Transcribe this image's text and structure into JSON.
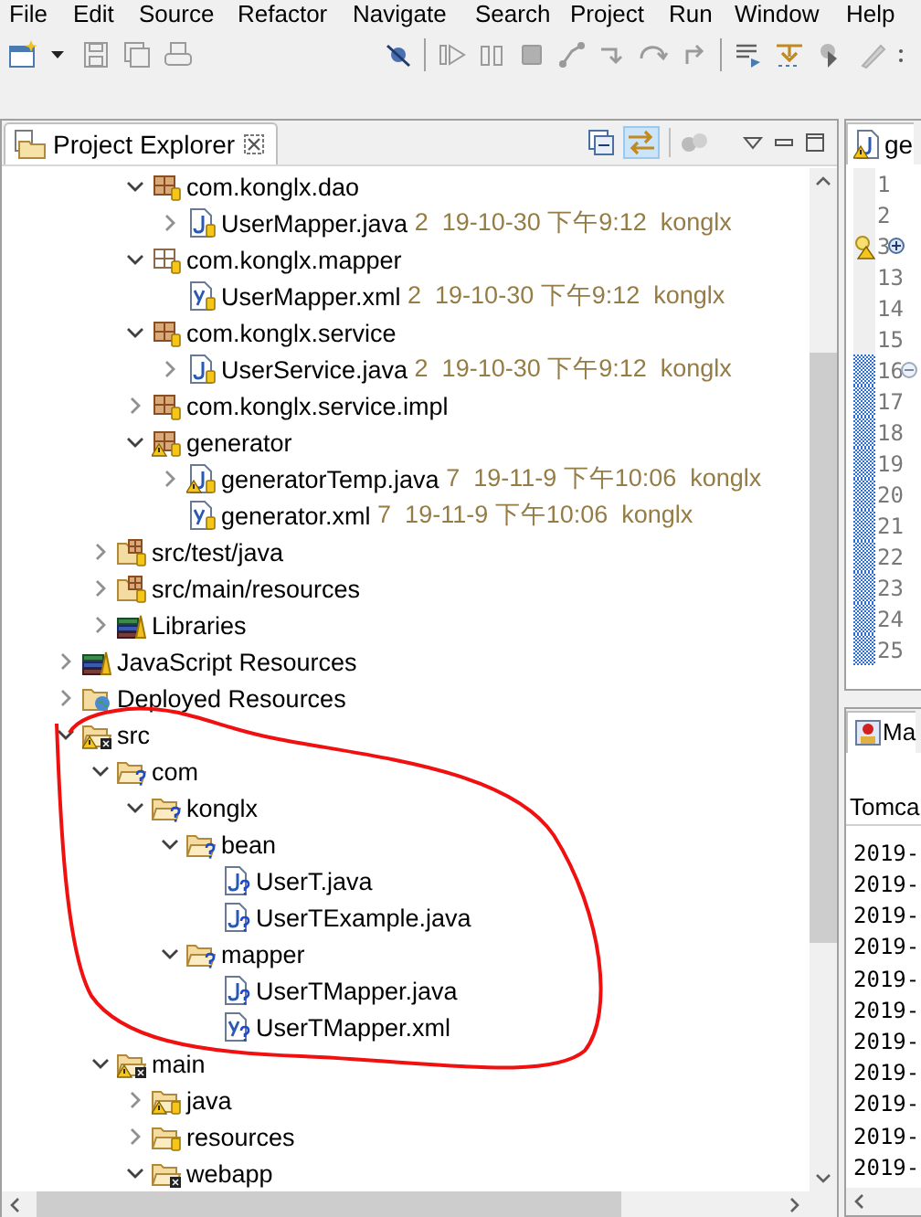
{
  "menu_bar": {
    "items": [
      "File",
      "Edit",
      "Source",
      "Refactor",
      "Navigate",
      "Search",
      "Project",
      "Run",
      "Window",
      "Help"
    ]
  },
  "project_explorer": {
    "tab": {
      "label": "Project Explorer"
    },
    "tree": [
      {
        "children": [
          {
            "children": [
              {
                "label": "com.konglx.dao",
                "kind": "package",
                "expanded": true,
                "children": [
                  {
                    "label": "UserMapper.java",
                    "decoration": "2  19-10-30 下午9:12  konglx",
                    "kind": "javafile",
                    "expanded": false
                  }
                ]
              },
              {
                "label": "com.konglx.mapper",
                "kind": "emptypackage",
                "expanded": true,
                "children": [
                  {
                    "label": "UserMapper.xml",
                    "decoration": "2  19-10-30 下午9:12  konglx",
                    "kind": "xmlfile"
                  }
                ]
              },
              {
                "label": "com.konglx.service",
                "kind": "package",
                "expanded": true,
                "children": [
                  {
                    "label": "UserService.java",
                    "decoration": "2  19-10-30 下午9:12  konglx",
                    "kind": "javafile",
                    "expanded": false
                  }
                ]
              },
              {
                "label": "com.konglx.service.impl",
                "kind": "package",
                "expanded": false
              },
              {
                "label": "generator",
                "kind": "warnpackage",
                "expanded": true,
                "children": [
                  {
                    "label": "generatorTemp.java",
                    "decoration": "7  19-11-9 下午10:06  konglx",
                    "kind": "warnjavafile",
                    "expanded": false
                  },
                  {
                    "label": "generator.xml",
                    "decoration": "7  19-11-9 下午10:06  konglx",
                    "kind": "xmlfile"
                  }
                ]
              }
            ]
          },
          {
            "label": "src/test/java",
            "kind": "sourcefolder",
            "expanded": false
          },
          {
            "label": "src/main/resources",
            "kind": "sourcefolder",
            "expanded": false
          },
          {
            "label": "Libraries",
            "kind": "library",
            "expanded": false
          }
        ]
      },
      {
        "label": "JavaScript Resources",
        "kind": "library",
        "expanded": false
      },
      {
        "label": "Deployed Resources",
        "kind": "deployed",
        "expanded": false
      },
      {
        "label": "src",
        "kind": "warnwebfolder",
        "expanded": true,
        "children": [
          {
            "label": "com",
            "kind": "newfolder",
            "expanded": true,
            "children": [
              {
                "label": "konglx",
                "kind": "newfolder",
                "expanded": true,
                "children": [
                  {
                    "label": "bean",
                    "kind": "newfolder",
                    "expanded": true,
                    "children": [
                      {
                        "label": "UserT.java",
                        "kind": "newjavafile"
                      },
                      {
                        "label": "UserTExample.java",
                        "kind": "newjavafile"
                      }
                    ]
                  },
                  {
                    "label": "mapper",
                    "kind": "newfolder",
                    "expanded": true,
                    "children": [
                      {
                        "label": "UserTMapper.java",
                        "kind": "newjavafile"
                      },
                      {
                        "label": "UserTMapper.xml",
                        "kind": "newxmlfile"
                      }
                    ]
                  }
                ]
              }
            ]
          },
          {
            "label": "main",
            "kind": "warnwebfolder",
            "expanded": true,
            "children": [
              {
                "label": "java",
                "kind": "warnsvnfolder",
                "expanded": false
              },
              {
                "label": "resources",
                "kind": "svnfolder",
                "expanded": false
              },
              {
                "label": "webapp",
                "kind": "webfolder",
                "expanded": true
              }
            ]
          }
        ]
      }
    ]
  },
  "editor": {
    "tab": {
      "label": "ge"
    },
    "lines": [
      {
        "number": "1",
        "kind": "plain",
        "highlight": false
      },
      {
        "number": "2",
        "kind": "plain",
        "highlight": false
      },
      {
        "number": "3",
        "kind": "folded",
        "highlight": false
      },
      {
        "number": "13",
        "kind": "plain",
        "highlight": false
      },
      {
        "number": "14",
        "kind": "plain",
        "highlight": false
      },
      {
        "number": "15",
        "kind": "plain",
        "highlight": false
      },
      {
        "number": "16",
        "kind": "foldstart",
        "highlight": true
      },
      {
        "number": "17",
        "kind": "plain",
        "highlight": true
      },
      {
        "number": "18",
        "kind": "plain",
        "highlight": true
      },
      {
        "number": "19",
        "kind": "plain",
        "highlight": true
      },
      {
        "number": "20",
        "kind": "plain",
        "highlight": true
      },
      {
        "number": "21",
        "kind": "plain",
        "highlight": true
      },
      {
        "number": "22",
        "kind": "plain",
        "highlight": true
      },
      {
        "number": "23",
        "kind": "plain",
        "highlight": true
      },
      {
        "number": "24",
        "kind": "plain",
        "highlight": true
      },
      {
        "number": "25",
        "kind": "plain",
        "highlight": true
      }
    ]
  },
  "bottom_view": {
    "tab": {
      "label": "Ma"
    },
    "column_header": "Tomca",
    "rows": [
      "2019-",
      "2019-",
      "2019-",
      "2019-",
      "2019-",
      "2019-",
      "2019-",
      "2019-",
      "2019-",
      "2019-",
      "2019-"
    ]
  }
}
